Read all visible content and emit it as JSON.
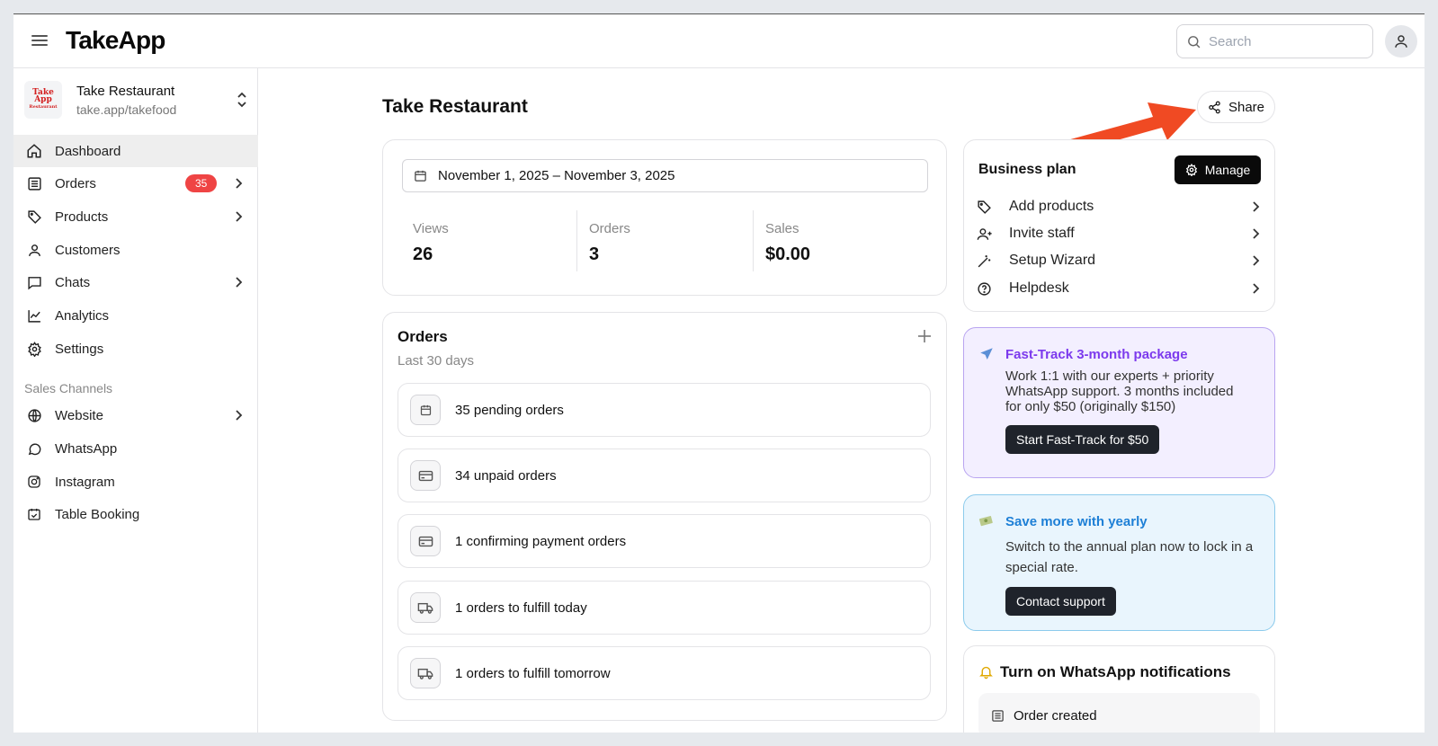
{
  "header": {
    "app_name": "TakeApp",
    "search_placeholder": "Search"
  },
  "store": {
    "name": "Take Restaurant",
    "url": "take.app/takefood",
    "logo_text": [
      "Take",
      "App",
      "Restaurant"
    ]
  },
  "sidebar": {
    "items": [
      {
        "label": "Dashboard",
        "icon": "home-icon"
      },
      {
        "label": "Orders",
        "icon": "orders-icon",
        "badge": "35"
      },
      {
        "label": "Products",
        "icon": "tag-icon"
      },
      {
        "label": "Customers",
        "icon": "user-icon"
      },
      {
        "label": "Chats",
        "icon": "chat-icon"
      },
      {
        "label": "Analytics",
        "icon": "chart-icon"
      },
      {
        "label": "Settings",
        "icon": "gear-icon"
      }
    ],
    "section_label": "Sales Channels",
    "channels": [
      {
        "label": "Website",
        "icon": "globe-icon"
      },
      {
        "label": "WhatsApp",
        "icon": "whatsapp-icon"
      },
      {
        "label": "Instagram",
        "icon": "instagram-icon"
      },
      {
        "label": "Table Booking",
        "icon": "calendar-check-icon"
      }
    ]
  },
  "main": {
    "title": "Take Restaurant",
    "share_label": "Share",
    "date_range": "November 1, 2025 – November 3, 2025",
    "stats": [
      {
        "label": "Views",
        "value": "26"
      },
      {
        "label": "Orders",
        "value": "3"
      },
      {
        "label": "Sales",
        "value": "$0.00"
      }
    ],
    "orders": {
      "title": "Orders",
      "subtitle": "Last 30 days",
      "rows": [
        {
          "text": "35 pending orders",
          "icon": "calendar-icon"
        },
        {
          "text": "34 unpaid orders",
          "icon": "card-icon"
        },
        {
          "text": "1 confirming payment orders",
          "icon": "card-icon"
        },
        {
          "text": "1 orders to fulfill today",
          "icon": "truck-icon"
        },
        {
          "text": "1 orders to fulfill tomorrow",
          "icon": "truck-icon"
        }
      ]
    }
  },
  "business_plan": {
    "title": "Business plan",
    "manage_label": "Manage",
    "items": [
      {
        "label": "Add products",
        "icon": "tag-icon"
      },
      {
        "label": "Invite staff",
        "icon": "user-plus-icon"
      },
      {
        "label": "Setup Wizard",
        "icon": "wand-icon"
      },
      {
        "label": "Helpdesk",
        "icon": "help-icon"
      }
    ]
  },
  "fast_track": {
    "title": "Fast-Track 3-month package",
    "lines": [
      "Work 1:1 with our experts + priority",
      "WhatsApp support. 3 months included",
      "for only $50 (originally $150)"
    ],
    "button": "Start Fast-Track for $50",
    "accent": "#7c3aed"
  },
  "yearly": {
    "title": "Save more with yearly",
    "lines": [
      "Switch to the annual plan now to lock in a",
      "special rate."
    ],
    "button": "Contact support",
    "accent": "#1d7fd6"
  },
  "whatsapp_notifications": {
    "title": "Turn on WhatsApp notifications",
    "item": "Order created"
  }
}
